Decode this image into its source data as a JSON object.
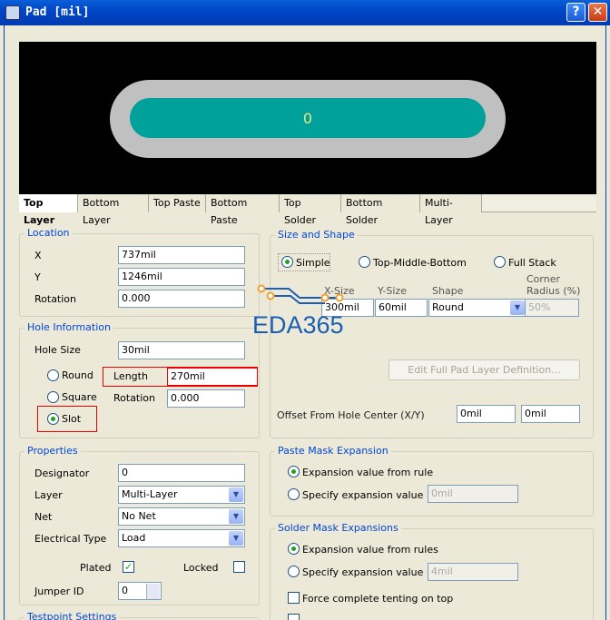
{
  "window": {
    "title": "Pad [mil]",
    "help_label": "?",
    "close_label": "✕"
  },
  "preview": {
    "pad_label": "0",
    "colors": {
      "pad": "#00a19a",
      "ring": "#c0c0c0"
    }
  },
  "tabs": [
    "Top Layer",
    "Bottom Layer",
    "Top Paste",
    "Bottom Paste",
    "Top Solder",
    "Bottom Solder",
    "Multi-Layer"
  ],
  "location": {
    "title": "Location",
    "x_label": "X",
    "x_value": "737mil",
    "y_label": "Y",
    "y_value": "1246mil",
    "rotation_label": "Rotation",
    "rotation_value": "0.000"
  },
  "hole": {
    "title": "Hole Information",
    "size_label": "Hole Size",
    "size_value": "30mil",
    "round_label": "Round",
    "length_label": "Length",
    "length_value": "270mil",
    "square_label": "Square",
    "rotation_label": "Rotation",
    "rotation_value": "0.000",
    "slot_label": "Slot"
  },
  "properties": {
    "title": "Properties",
    "designator_label": "Designator",
    "designator_value": "0",
    "layer_label": "Layer",
    "layer_value": "Multi-Layer",
    "net_label": "Net",
    "net_value": "No Net",
    "etype_label": "Electrical Type",
    "etype_value": "Load",
    "plated_label": "Plated",
    "locked_label": "Locked",
    "jumper_label": "Jumper ID",
    "jumper_value": "0"
  },
  "testpoint": {
    "title": "Testpoint Settings"
  },
  "size_shape": {
    "title": "Size and Shape",
    "simple_label": "Simple",
    "tmb_label": "Top-Middle-Bottom",
    "full_label": "Full Stack",
    "xsize_header": "X-Size",
    "ysize_header": "Y-Size",
    "shape_header": "Shape",
    "corner_header": "Corner Radius (%)",
    "xsize_value": "300mil",
    "ysize_value": "60mil",
    "shape_value": "Round",
    "corner_value": "50%",
    "edit_button": "Edit Full Pad Layer Definition...",
    "offset_label": "Offset From Hole Center (X/Y)",
    "offset_x": "0mil",
    "offset_y": "0mil"
  },
  "watermark": {
    "text": "EDA365",
    "color": "#1a5fb4"
  },
  "paste": {
    "title": "Paste Mask Expansion",
    "rule_label": "Expansion value from rule",
    "specify_label": "Specify expansion value",
    "value": "0mil"
  },
  "solder": {
    "title": "Solder Mask Expansions",
    "rule_label": "Expansion value from rules",
    "specify_label": "Specify expansion value",
    "value": "4mil",
    "tent_label": "Force complete tenting on top"
  }
}
